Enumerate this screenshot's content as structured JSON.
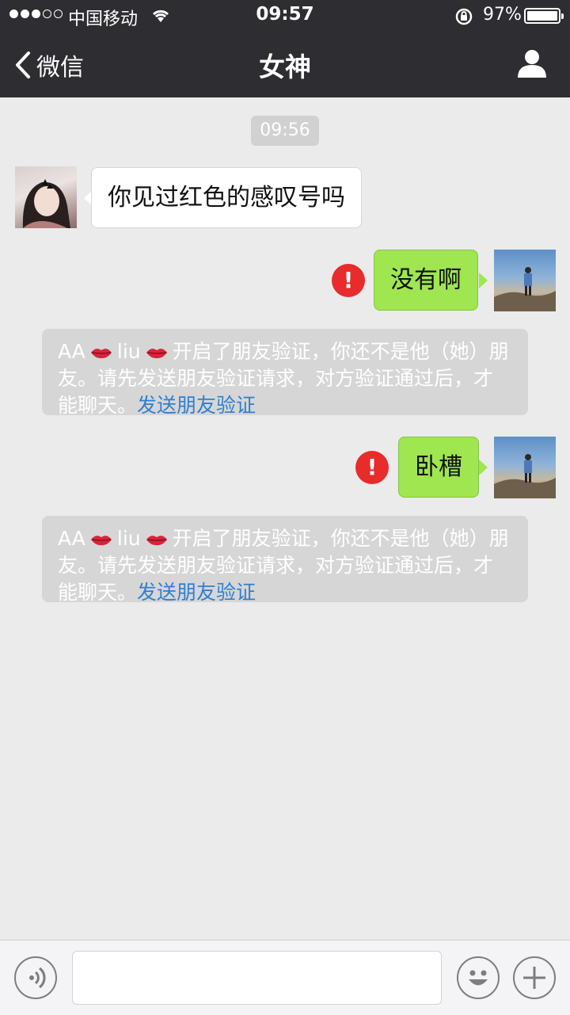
{
  "status_bar": {
    "carrier": "中国移动",
    "time": "09:57",
    "battery": "97%"
  },
  "nav": {
    "back_label": "微信",
    "title": "女神"
  },
  "chat": {
    "timestamp": "09:56",
    "incoming_message": "你见过红色的感叹号吗",
    "outgoing_1": "没有啊",
    "outgoing_2": "卧槽",
    "error_mark": "!",
    "system_notice": {
      "name_part1": "AA",
      "name_part2": "liu",
      "text": "开启了朋友验证，你还不是他（她）朋友。请先发送朋友验证请求，对方验证通过后，才能聊天。",
      "link": "发送朋友验证"
    }
  },
  "icons": {
    "back": "chevron-left-icon",
    "profile": "person-icon",
    "voice": "voice-icon",
    "emoji": "emoji-icon",
    "plus": "plus-icon"
  },
  "colors": {
    "nav_bg": "#2e2e32",
    "chat_bg": "#ebebeb",
    "outgoing_bubble": "#9fe651",
    "error_red": "#e82b2b",
    "link_blue": "#2f7fd1"
  }
}
